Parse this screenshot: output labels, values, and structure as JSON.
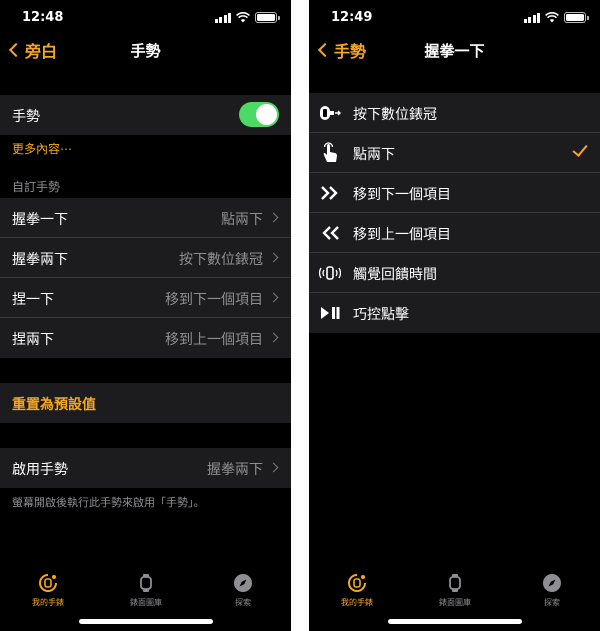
{
  "colors": {
    "accent": "#f5a623",
    "toggle_on": "#4cd964",
    "cell_bg": "#1c1c1e",
    "secondary_text": "#8e8e93"
  },
  "left": {
    "status": {
      "time": "12:48"
    },
    "nav": {
      "back_label": "旁白",
      "title": "手勢"
    },
    "gestures_toggle": {
      "label": "手勢",
      "state": "on"
    },
    "more_link": "更多內容⋯",
    "section_header": "自訂手勢",
    "custom_gestures": [
      {
        "label": "握拳一下",
        "value": "點兩下"
      },
      {
        "label": "握拳兩下",
        "value": "按下數位錶冠"
      },
      {
        "label": "捏一下",
        "value": "移到下一個項目"
      },
      {
        "label": "捏兩下",
        "value": "移到上一個項目"
      }
    ],
    "reset_label": "重置為預設值",
    "enable": {
      "label": "啟用手勢",
      "value": "握拳兩下"
    },
    "footnote": "螢幕開啟後執行此手勢來啟用「手勢」。"
  },
  "right": {
    "status": {
      "time": "12:49"
    },
    "nav": {
      "back_label": "手勢",
      "title": "握拳一下"
    },
    "options": [
      {
        "icon": "digital-crown-icon",
        "label": "按下數位錶冠",
        "selected": false
      },
      {
        "icon": "tap-hand-icon",
        "label": "點兩下",
        "selected": true
      },
      {
        "icon": "double-chevron-right-icon",
        "label": "移到下一個項目",
        "selected": false
      },
      {
        "icon": "double-chevron-left-icon",
        "label": "移到上一個項目",
        "selected": false
      },
      {
        "icon": "haptic-icon",
        "label": "觸覺回饋時間",
        "selected": false
      },
      {
        "icon": "play-pause-icon",
        "label": "巧控點擊",
        "selected": false
      }
    ]
  },
  "tabs": [
    {
      "icon": "my-watch-icon",
      "label": "我的手錶",
      "active": true
    },
    {
      "icon": "face-gallery-icon",
      "label": "錶面圖庫",
      "active": false
    },
    {
      "icon": "discover-icon",
      "label": "探索",
      "active": false
    }
  ]
}
